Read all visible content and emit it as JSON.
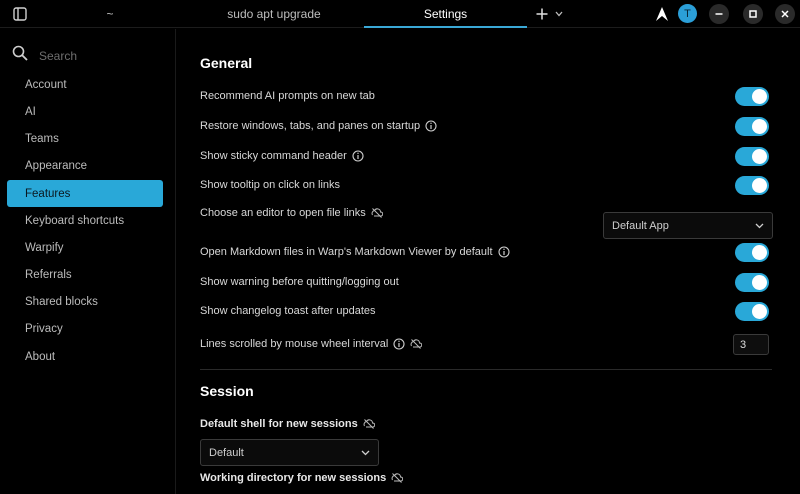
{
  "tabbar": {
    "tabs": [
      {
        "label": "~"
      },
      {
        "label": "sudo apt upgrade"
      },
      {
        "label": "Settings"
      }
    ],
    "avatar_letter": "T",
    "accent": "#29a8d8"
  },
  "sidebar": {
    "search_placeholder": "Search",
    "items": [
      {
        "label": "Account"
      },
      {
        "label": "AI"
      },
      {
        "label": "Teams"
      },
      {
        "label": "Appearance"
      },
      {
        "label": "Features"
      },
      {
        "label": "Keyboard shortcuts"
      },
      {
        "label": "Warpify"
      },
      {
        "label": "Referrals"
      },
      {
        "label": "Shared blocks"
      },
      {
        "label": "Privacy"
      },
      {
        "label": "About"
      }
    ],
    "active_item": "Features"
  },
  "general": {
    "title": "General",
    "settings": [
      {
        "label": "Recommend AI prompts on new tab",
        "on": true
      },
      {
        "label": "Restore windows, tabs, and panes on startup",
        "on": true
      },
      {
        "label": "Show sticky command header",
        "on": true
      },
      {
        "label": "Show tooltip on click on links",
        "on": true
      },
      {
        "label": "Choose an editor to open file links",
        "value": "Default App"
      },
      {
        "label": "Open Markdown files in Warp's Markdown Viewer by default",
        "on": true
      },
      {
        "label": "Show warning before quitting/logging out",
        "on": true
      },
      {
        "label": "Show changelog toast after updates",
        "on": true
      },
      {
        "label": "Lines scrolled by mouse wheel interval",
        "value": "3"
      }
    ]
  },
  "session": {
    "title": "Session",
    "default_shell_label": "Default shell for new sessions",
    "default_shell_value": "Default",
    "working_dir_label": "Working directory for new sessions"
  }
}
